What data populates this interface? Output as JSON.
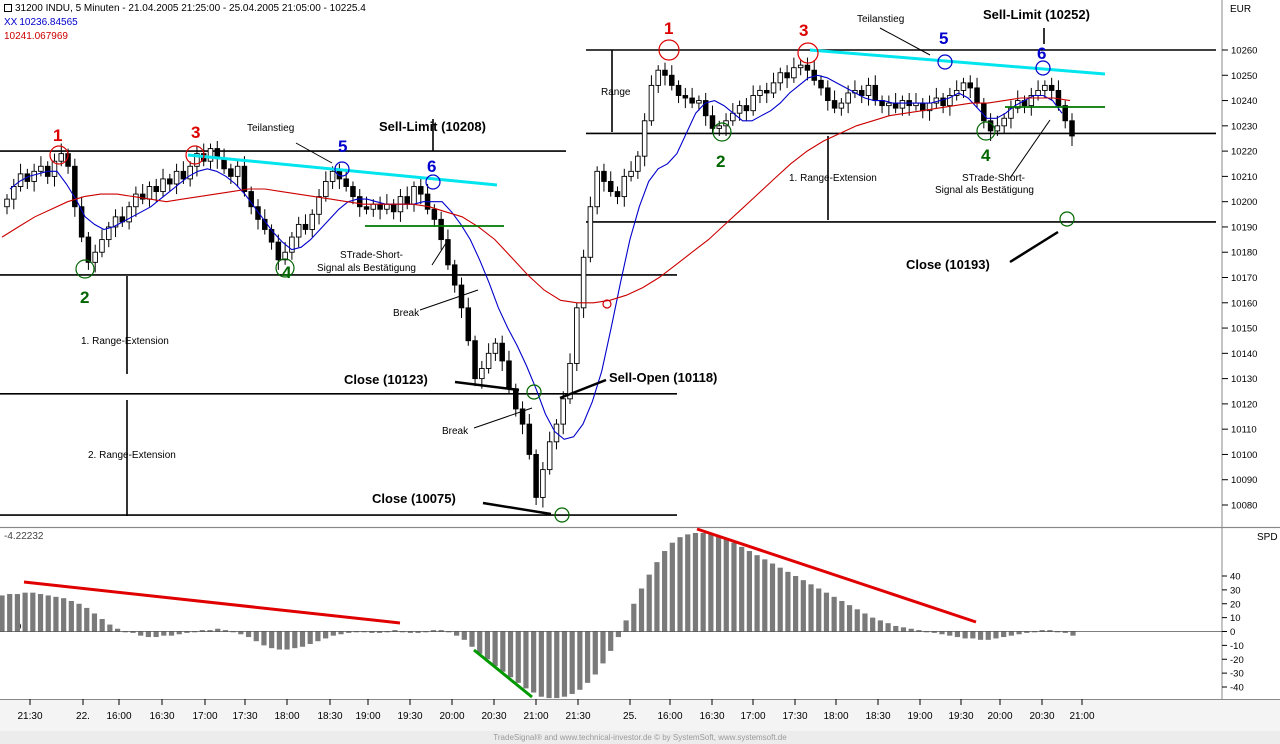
{
  "header": {
    "line1": "31200 INDU, 5 Minuten - 21.04.2005 21:25:00 - 25.04.2005 21:05:00 - 10225.4",
    "line2": "10236.84565",
    "line2_prefix": "XX",
    "line3": "10241.067969",
    "currency": "EUR",
    "osc_name": "SPD",
    "osc_value": "-4.22232"
  },
  "colors": {
    "background": "#f4f4f4",
    "candle": "#000000",
    "ma_fast": "#0000cc",
    "ma_slow": "#cc0000",
    "trend_cyan": "#00e5ee",
    "level_green": "#007700",
    "red_label": "#dd0000",
    "green_label": "#006600",
    "blue_label": "#0000cc",
    "histogram": "#7a7a7a",
    "osc_red_line": "#e00000",
    "osc_green_line": "#009900"
  },
  "footer": "TradeSignal® and www.technical-investor.de © by  SystemSoft, www.systemsoft.de",
  "chart_data": [
    {
      "type": "candlestick",
      "title": "",
      "ylim": [
        10070,
        10270
      ],
      "y_ticks": [
        10080,
        10090,
        10100,
        10110,
        10120,
        10130,
        10140,
        10150,
        10160,
        10170,
        10180,
        10190,
        10200,
        10210,
        10220,
        10230,
        10240,
        10250,
        10260
      ],
      "x_ticks": [
        "21:30",
        "22.",
        "16:00",
        "16:30",
        "17:00",
        "17:30",
        "18:00",
        "18:30",
        "19:00",
        "19:30",
        "20:00",
        "20:30",
        "21:00",
        "21:30",
        "25.",
        "16:00",
        "16:30",
        "17:00",
        "17:30",
        "18:00",
        "18:30",
        "19:00",
        "19:30",
        "20:00",
        "20:30",
        "21:00"
      ],
      "close_series": [
        10201,
        10206,
        10211,
        10208,
        10212,
        10214,
        10210,
        10216,
        10219,
        10214,
        10198,
        10186,
        10176,
        10180,
        10185,
        10190,
        10194,
        10192,
        10198,
        10203,
        10201,
        10206,
        10204,
        10209,
        10207,
        10212,
        10209,
        10214,
        10219,
        10216,
        10221,
        10217,
        10213,
        10210,
        10214,
        10204,
        10198,
        10193,
        10189,
        10184,
        10177,
        10180,
        10186,
        10191,
        10189,
        10195,
        10202,
        10208,
        10212,
        10209,
        10206,
        10202,
        10198,
        10197,
        10199,
        10197,
        10199,
        10196,
        10202,
        10199,
        10206,
        10203,
        10197,
        10193,
        10185,
        10175,
        10167,
        10158,
        10145,
        10130,
        10134,
        10140,
        10144,
        10137,
        10126,
        10118,
        10112,
        10100,
        10083,
        10094,
        10105,
        10112,
        10122,
        10136,
        10158,
        10178,
        10198,
        10212,
        10208,
        10204,
        10202,
        10210,
        10212,
        10218,
        10232,
        10246,
        10252,
        10250,
        10246,
        10242,
        10241,
        10239,
        10240,
        10234,
        10229,
        10230,
        10232,
        10235,
        10238,
        10236,
        10242,
        10244,
        10243,
        10247,
        10251,
        10249,
        10253,
        10254,
        10252,
        10248,
        10245,
        10240,
        10237,
        10239,
        10243,
        10244,
        10242,
        10246,
        10240,
        10238,
        10239,
        10237,
        10240,
        10238,
        10239,
        10236,
        10239,
        10241,
        10238,
        10242,
        10244,
        10247,
        10245,
        10239,
        10232,
        10228,
        10230,
        10233,
        10237,
        10240,
        10238,
        10242,
        10244,
        10246,
        10244,
        10238,
        10232,
        10226
      ],
      "ma_fast": [
        10205,
        10208,
        10210,
        10211,
        10212,
        10212,
        10207,
        10201,
        10194,
        10191,
        10189,
        10190,
        10192,
        10194,
        10196,
        10198,
        10201,
        10204,
        10207,
        10210,
        10212,
        10213,
        10212,
        10210,
        10207,
        10203,
        10198,
        10193,
        10188,
        10184,
        10181,
        10182,
        10185,
        10189,
        10193,
        10197,
        10200,
        10201,
        10201,
        10200,
        10199,
        10199,
        10199,
        10199,
        10200,
        10200,
        10200,
        10196,
        10191,
        10185,
        10177,
        10168,
        10158,
        10150,
        10143,
        10135,
        10126,
        10116,
        10109,
        10106,
        10107,
        10112,
        10121,
        10133,
        10150,
        10168,
        10185,
        10198,
        10208,
        10213,
        10215,
        10219,
        10227,
        10235,
        10239,
        10240,
        10238,
        10235,
        10232,
        10232,
        10234,
        10236,
        10239,
        10243,
        10246,
        10249,
        10250,
        10249,
        10247,
        10245,
        10243,
        10241,
        10240,
        10240,
        10239,
        10239,
        10239,
        10239,
        10239,
        10240,
        10241,
        10243,
        10241,
        10237,
        10233,
        10233,
        10235,
        10238,
        10240,
        10242,
        10242,
        10240,
        10235
      ],
      "ma_slow": [
        10186,
        10190,
        10194,
        10197,
        10200,
        10202,
        10203,
        10203,
        10202,
        10201,
        10200,
        10201,
        10202,
        10203,
        10204,
        10205,
        10205,
        10204,
        10203,
        10202,
        10201,
        10200,
        10199,
        10199,
        10199,
        10199,
        10198,
        10196,
        10194,
        10190,
        10185,
        10178,
        10171,
        10165,
        10161,
        10160,
        10160,
        10161,
        10163,
        10166,
        10170,
        10175,
        10180,
        10185,
        10191,
        10197,
        10203,
        10209,
        10215,
        10220,
        10224,
        10227,
        10230,
        10232,
        10234,
        10235,
        10236,
        10237,
        10238,
        10239,
        10239,
        10240,
        10241,
        10241,
        10241,
        10240
      ],
      "horizontal_levels": [
        10220,
        10171,
        10124,
        10076,
        10260,
        10227,
        10192
      ],
      "labels": {
        "n1": "1",
        "n2": "2",
        "n3": "3",
        "n4": "4",
        "n5": "5",
        "n6": "6",
        "teilanstieg": "Teilanstieg",
        "sell_limit_1": "Sell-Limit (10208)",
        "sell_limit_2": "Sell-Limit (10252)",
        "range": "Range",
        "range_ext_1": "1. Range-Extension",
        "range_ext_2": "2. Range-Extension",
        "strade_short_1a": "STrade-Short-",
        "strade_short_1b": "Signal als Bestätigung",
        "strade_short_2a": "STrade-Short-",
        "strade_short_2b": "Signal als Bestätigung",
        "break_1": "Break",
        "break_2": "Break",
        "close_10123": "Close (10123)",
        "close_10075": "Close (10075)",
        "close_10193": "Close (10193)",
        "sell_open": "Sell-Open (10118)"
      }
    },
    {
      "type": "bar",
      "title": "SPD",
      "ylim": [
        -48,
        70
      ],
      "y_ticks": [
        40,
        30,
        20,
        10,
        0,
        -10,
        -20,
        -30,
        -40
      ],
      "values": [
        26,
        27,
        27,
        28,
        28,
        27,
        26,
        25,
        24,
        22,
        20,
        17,
        13,
        9,
        5,
        2,
        0,
        -1,
        -3,
        -4,
        -4,
        -3,
        -3,
        -2,
        -1,
        0,
        1,
        1,
        2,
        1,
        0,
        -2,
        -4,
        -7,
        -10,
        -12,
        -13,
        -13,
        -12,
        -11,
        -9,
        -7,
        -5,
        -3,
        -2,
        -1,
        0,
        0,
        -1,
        -1,
        0,
        1,
        0,
        -1,
        -1,
        0,
        1,
        1,
        0,
        -3,
        -6,
        -11,
        -16,
        -20,
        -25,
        -29,
        -33,
        -37,
        -41,
        -44,
        -47,
        -48,
        -48,
        -47,
        -45,
        -42,
        -37,
        -31,
        -23,
        -14,
        -4,
        8,
        20,
        31,
        41,
        50,
        58,
        64,
        68,
        70,
        71,
        71,
        70,
        69,
        67,
        64,
        61,
        58,
        55,
        52,
        49,
        46,
        43,
        40,
        37,
        34,
        31,
        28,
        25,
        22,
        19,
        16,
        13,
        10,
        8,
        6,
        4,
        3,
        2,
        1,
        0,
        -1,
        -2,
        -3,
        -4,
        -5,
        -5,
        -6,
        -6,
        -5,
        -4,
        -3,
        -2,
        -1,
        0,
        1,
        1,
        0,
        -1,
        -3
      ]
    }
  ]
}
